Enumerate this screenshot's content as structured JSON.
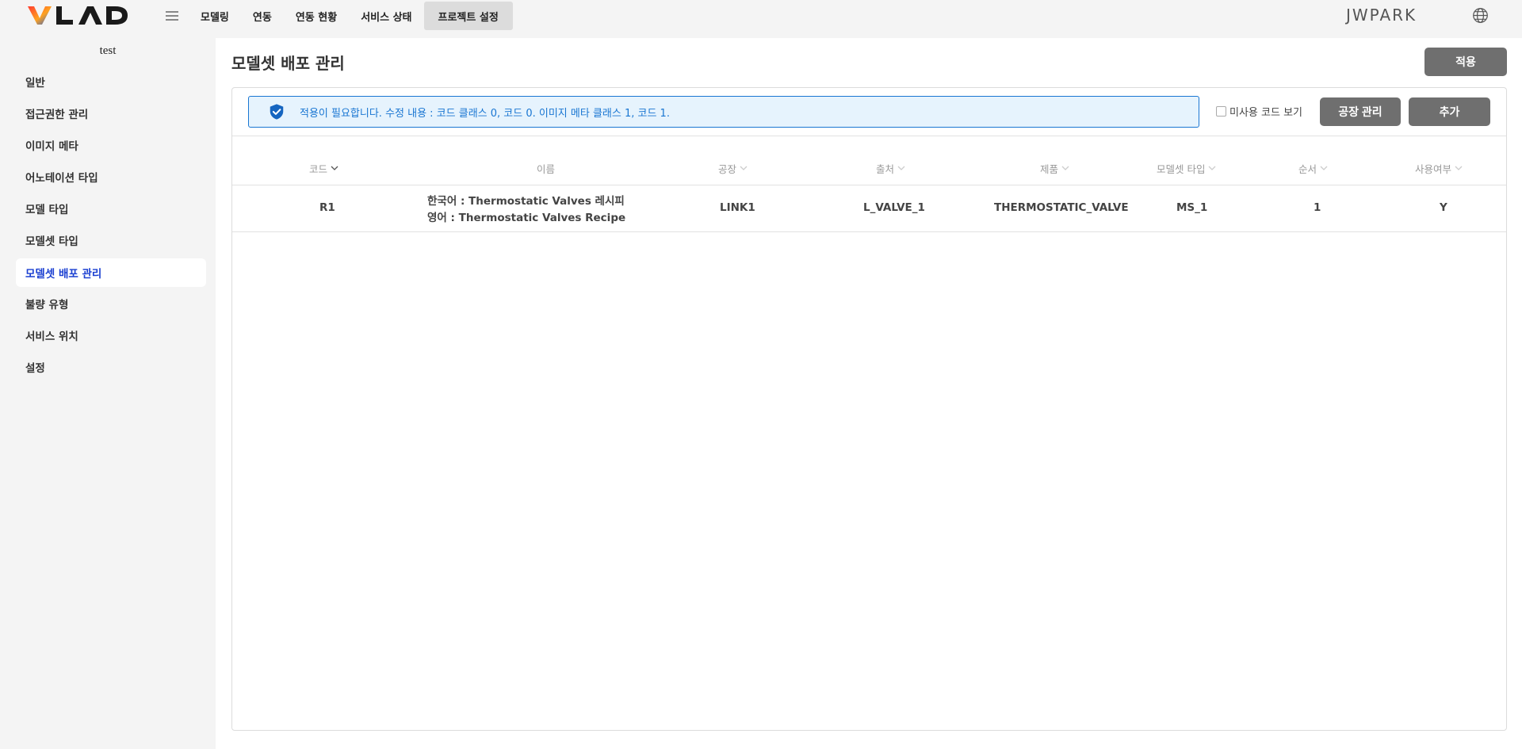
{
  "app": {
    "logo_text": "VLAD",
    "user": "JWPARK"
  },
  "topnav": {
    "items": [
      {
        "label": "모델링"
      },
      {
        "label": "연동"
      },
      {
        "label": "연동 현황"
      },
      {
        "label": "서비스 상태"
      },
      {
        "label": "프로젝트 설정",
        "active": true
      }
    ]
  },
  "sidebar": {
    "project": "test",
    "items": [
      {
        "label": "일반"
      },
      {
        "label": "접근권한 관리"
      },
      {
        "label": "이미지 메타"
      },
      {
        "label": "어노테이션 타입"
      },
      {
        "label": "모델 타입"
      },
      {
        "label": "모델셋 타입"
      },
      {
        "label": "모델셋 배포 관리",
        "active": true
      },
      {
        "label": "불량 유형"
      },
      {
        "label": "서비스 위치"
      },
      {
        "label": "설정"
      }
    ]
  },
  "main": {
    "title": "모델셋 배포 관리",
    "apply_label": "적용",
    "alert": "적용이 필요합니다. 수정 내용 : 코드 클래스 0, 코드 0. 이미지 메타 클래스 1, 코드 1.",
    "show_unused_label": "미사용 코드 보기",
    "show_unused_checked": false,
    "factory_btn": "공장 관리",
    "add_btn": "추가"
  },
  "table": {
    "headers": [
      "코드",
      "이름",
      "공장",
      "출처",
      "제품",
      "모델셋 타입",
      "순서",
      "사용여부"
    ],
    "rows": [
      {
        "code": "R1",
        "name_ko": "한국어 : Thermostatic Valves 레시피",
        "name_en": "영어 : Thermostatic Valves Recipe",
        "factory": "LINK1",
        "source": "L_VALVE_1",
        "product": "THERMOSTATIC_VALVE",
        "modelset_type": "MS_1",
        "order": "1",
        "use": "Y"
      }
    ]
  },
  "colors": {
    "accent": "#1a3fd1",
    "alert_border": "#1976d2",
    "alert_bg": "#e6f3fd",
    "button_bg": "#6f6f6f"
  }
}
